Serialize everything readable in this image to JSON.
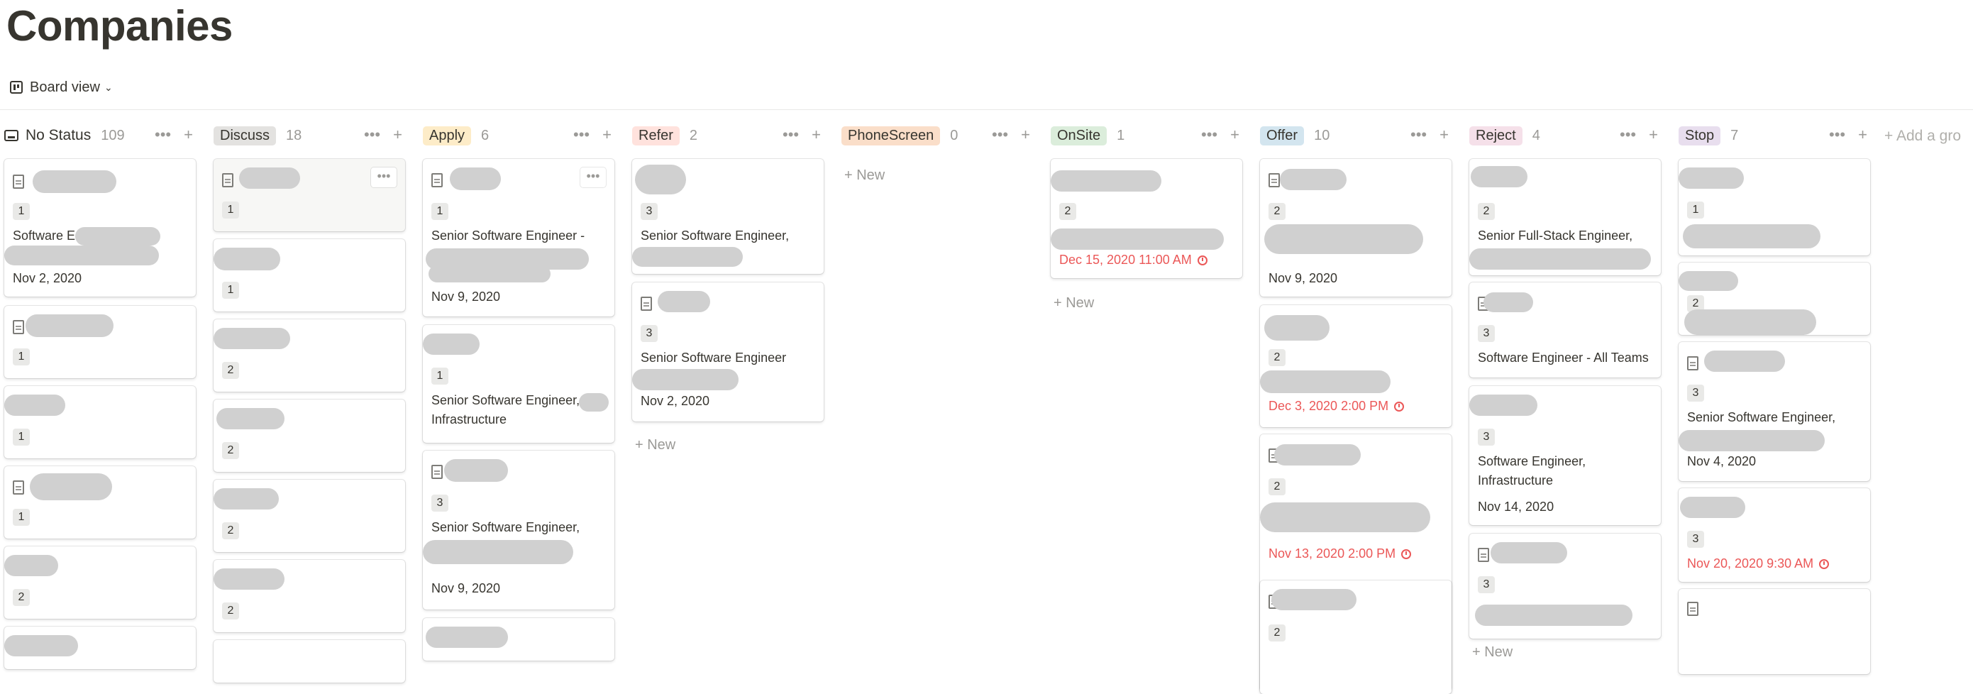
{
  "page": {
    "title": "Companies"
  },
  "view": {
    "label": "Board view"
  },
  "board": {
    "add_group_label": "+ Add a gro",
    "new_label": "+ New",
    "columns": [
      {
        "name": "No Status",
        "count": "109",
        "color": "#ffffff"
      },
      {
        "name": "Discuss",
        "count": "18",
        "color": "#e3e2e0"
      },
      {
        "name": "Apply",
        "count": "6",
        "color": "#fdecc8"
      },
      {
        "name": "Refer",
        "count": "2",
        "color": "#ffe2dd"
      },
      {
        "name": "PhoneScreen",
        "count": "0",
        "color": "#fadec9"
      },
      {
        "name": "OnSite",
        "count": "1",
        "color": "#dbeddb"
      },
      {
        "name": "Offer",
        "count": "10",
        "color": "#d3e5ef"
      },
      {
        "name": "Reject",
        "count": "4",
        "color": "#f5e0e9"
      },
      {
        "name": "Stop",
        "count": "7",
        "color": "#e8deee"
      }
    ]
  },
  "cards": {
    "nostatus": [
      {
        "num": "1",
        "text": "Software Enginee",
        "date": "Nov 2, 2020"
      },
      {
        "num": "1"
      },
      {
        "num": "1"
      },
      {
        "num": "1"
      },
      {
        "num": "2"
      }
    ],
    "discuss": [
      {
        "num": "1"
      },
      {
        "num": "1"
      },
      {
        "num": "2"
      },
      {
        "num": "2"
      },
      {
        "num": "2"
      },
      {
        "num": "2"
      }
    ],
    "apply": [
      {
        "num": "1",
        "text": "Senior Software Engineer -",
        "date": "Nov 9, 2020"
      },
      {
        "num": "1",
        "text": "Senior Software Engineer,\nInfrastructure"
      },
      {
        "num": "3",
        "text": "Senior Software Engineer,",
        "date": "Nov 9, 2020"
      }
    ],
    "refer": [
      {
        "num": "3",
        "text": "Senior Software Engineer,"
      },
      {
        "num": "3",
        "text": "Senior Software Engineer",
        "date": "Nov 2, 2020"
      }
    ],
    "onsite": [
      {
        "num": "2",
        "date": "Dec 15, 2020 11:00 AM"
      }
    ],
    "offer": [
      {
        "num": "2",
        "date": "Nov 9, 2020"
      },
      {
        "num": "2",
        "date": "Dec 3, 2020 2:00 PM"
      },
      {
        "num": "2",
        "date": "Nov 13, 2020 2:00 PM"
      },
      {
        "num": "2"
      }
    ],
    "reject": [
      {
        "num": "2",
        "text": "Senior Full-Stack Engineer,"
      },
      {
        "num": "3",
        "text": "Software Engineer - All Teams"
      },
      {
        "num": "3",
        "text": "Software Engineer,\nInfrastructure",
        "date": "Nov 14, 2020"
      },
      {
        "num": "3"
      }
    ],
    "stop": [
      {
        "num": "1"
      },
      {
        "num": "2"
      },
      {
        "num": "3",
        "text": "Senior Software Engineer,",
        "date": "Nov 4, 2020"
      },
      {
        "num": "3",
        "date": "Nov 20, 2020 9:30 AM"
      }
    ]
  },
  "icons": [
    "board-view-icon",
    "chevron-down-icon",
    "more-icon",
    "plus-icon",
    "document-icon",
    "alarm-clock-icon",
    "inbox-icon"
  ],
  "colors": {
    "text": "#37352f",
    "muted": "#9b9a97",
    "reminder": "#eb5757",
    "redaction": "#d0d0d0"
  }
}
